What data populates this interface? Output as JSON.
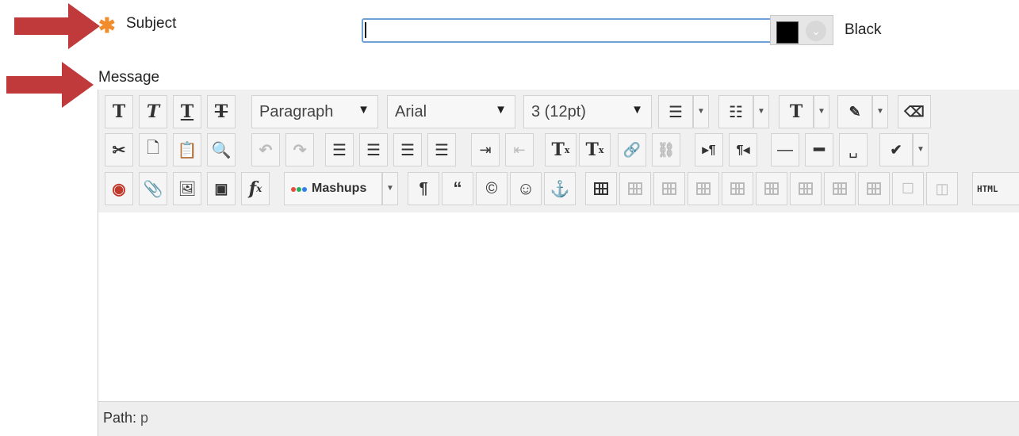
{
  "form": {
    "subject_label": "Subject",
    "subject_value": "",
    "color_name": "Black",
    "color_value": "#000000",
    "message_label": "Message"
  },
  "toolbar": {
    "row1": {
      "bold": "T",
      "italic": "T",
      "underline": "T",
      "strike": "T",
      "format_select": "Paragraph",
      "font_select": "Arial",
      "size_select": "3 (12pt)",
      "text_color": "T"
    },
    "row2": {
      "superscript": "T",
      "subscript": "T",
      "superscript_mark": "x",
      "subscript_mark": "x"
    },
    "row3": {
      "math": "f",
      "math_sub": "x",
      "mashups": "Mashups",
      "html": "HTML"
    }
  },
  "status": {
    "path_label": "Path:",
    "path_value": "p"
  },
  "colors": {
    "required": "#f08c2c",
    "input_border": "#6fa0d6",
    "arrow": "#c0393b"
  }
}
